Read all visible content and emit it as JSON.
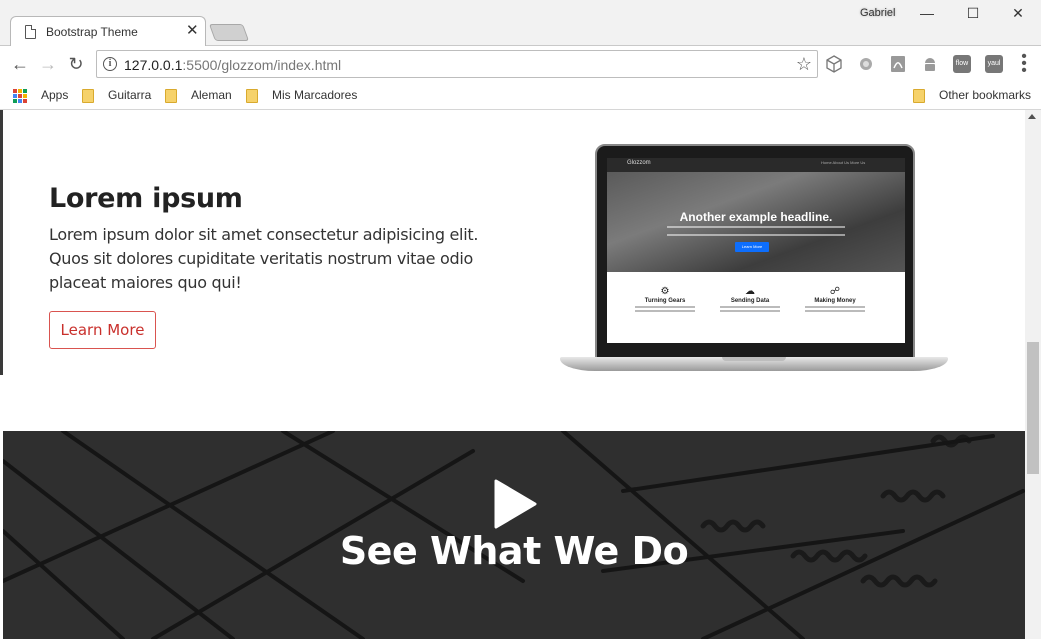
{
  "browser": {
    "tab_title": "Bootstrap Theme",
    "tab_close": "✕",
    "user": "Gabriel",
    "url_host": "127.0.0.1",
    "url_rest": ":5500/glozzom/index.html",
    "extensions": [
      {
        "name": "flow-extension",
        "label": "flow"
      },
      {
        "name": "yaul-extension",
        "label": "yaul"
      }
    ]
  },
  "bookmarks": {
    "apps": "Apps",
    "items": [
      "Guitarra",
      "Aleman",
      "Mis Marcadores"
    ],
    "other": "Other bookmarks"
  },
  "page": {
    "section_title": "Lorem ipsum",
    "section_text": "Lorem ipsum dolor sit amet consectetur adipisicing elit. Quos sit dolores cupiditate veritatis nostrum vitae odio placeat maiores quo qui!",
    "button_label": "Learn More",
    "laptop_screen": {
      "brand": "Glozzom",
      "nav_links": "Home   About Us   More Us",
      "hero_title": "Another example headline.",
      "hero_button": "Learn More",
      "features": [
        {
          "icon": "gear-icon",
          "title": "Turning Gears"
        },
        {
          "icon": "cloud-icon",
          "title": "Sending Data"
        },
        {
          "icon": "cart-icon",
          "title": "Making Money"
        }
      ]
    },
    "video_title": "See What We Do"
  },
  "colors": {
    "accent": "#d9534f",
    "video_bg": "#2f2f2f"
  }
}
